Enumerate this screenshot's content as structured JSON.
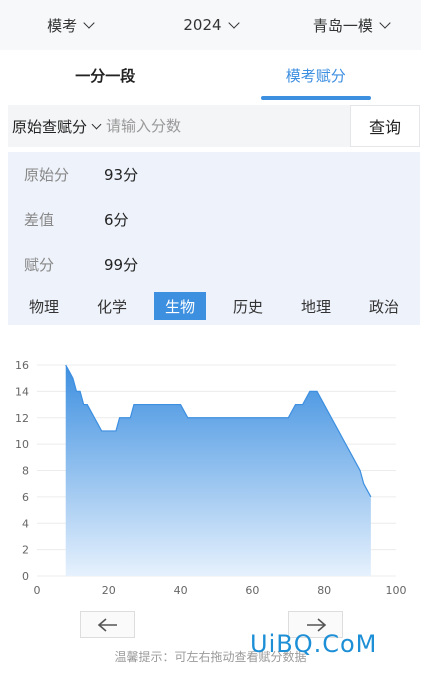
{
  "filters": [
    {
      "label": "模考"
    },
    {
      "label": "2024"
    },
    {
      "label": "青岛一模"
    }
  ],
  "tabs": [
    {
      "label": "一分一段",
      "active": false
    },
    {
      "label": "模考赋分",
      "active": true
    }
  ],
  "query": {
    "type_label": "原始查赋分",
    "placeholder": "请输入分数",
    "button_label": "查询"
  },
  "results": [
    {
      "label": "原始分",
      "value": "93分"
    },
    {
      "label": "差值",
      "value": "6分"
    },
    {
      "label": "赋分",
      "value": "99分"
    }
  ],
  "subjects": [
    {
      "label": "物理",
      "active": false
    },
    {
      "label": "化学",
      "active": false
    },
    {
      "label": "生物",
      "active": true
    },
    {
      "label": "历史",
      "active": false
    },
    {
      "label": "地理",
      "active": false
    },
    {
      "label": "政治",
      "active": false
    }
  ],
  "colors": {
    "accent": "#3d8fe0",
    "area_top": "#3d8fe0",
    "area_bottom": "#e6f1fd"
  },
  "chart_data": {
    "type": "area",
    "x": [
      8,
      9,
      10,
      11,
      12,
      13,
      14,
      15,
      16,
      17,
      18,
      19,
      20,
      21,
      22,
      23,
      24,
      25,
      26,
      27,
      40,
      42,
      70,
      72,
      74,
      76,
      78,
      80,
      82,
      84,
      86,
      87,
      88,
      89,
      90,
      91,
      92,
      93
    ],
    "y": [
      16,
      15.5,
      15,
      14,
      14,
      13,
      13,
      12.5,
      12,
      11.5,
      11,
      11,
      11,
      11,
      11,
      12,
      12,
      12,
      12,
      13,
      13,
      12,
      12,
      13,
      13,
      14,
      14,
      13,
      12,
      11,
      10,
      9.5,
      9,
      8.5,
      8,
      7,
      6.5,
      6
    ],
    "xlim": [
      0,
      100
    ],
    "ylim": [
      0,
      16
    ],
    "xticks": [
      0,
      20,
      40,
      60,
      80,
      100
    ],
    "yticks": [
      0,
      2,
      4,
      6,
      8,
      10,
      12,
      14,
      16
    ],
    "xlabel": "",
    "ylabel": "",
    "grid": true
  },
  "nav": {
    "prev_icon": "arrow-left-icon",
    "next_icon": "arrow-right-icon"
  },
  "tip": "温馨提示：可左右拖动查看赋分数据",
  "watermark": "UiBQ.CoM"
}
